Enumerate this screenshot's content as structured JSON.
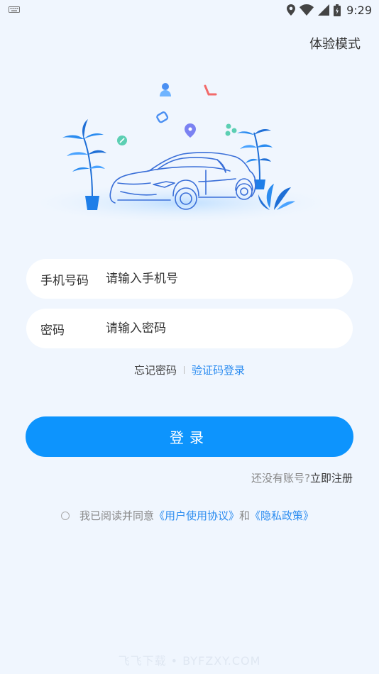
{
  "status_bar": {
    "time": "9:29"
  },
  "header": {
    "trial_mode_label": "体验模式"
  },
  "phone_field": {
    "label": "手机号码",
    "placeholder": "请输入手机号",
    "value": ""
  },
  "password_field": {
    "label": "密码",
    "placeholder": "请输入密码",
    "value": ""
  },
  "links": {
    "forgot_password": "忘记密码",
    "sms_login": "验证码登录"
  },
  "login_button": {
    "label": "登录"
  },
  "register": {
    "prompt": "还没有账号?",
    "link": "立即注册"
  },
  "agreement": {
    "prefix": "我已阅读并同意",
    "user_agreement": "《用户使用协议》",
    "conjunction": "和",
    "privacy_policy": "《隐私政策》"
  },
  "watermark": "飞飞下载 • BYFZXY.COM",
  "colors": {
    "primary": "#0d94fd",
    "link": "#2b8cf0",
    "background": "#f0f6fe"
  }
}
